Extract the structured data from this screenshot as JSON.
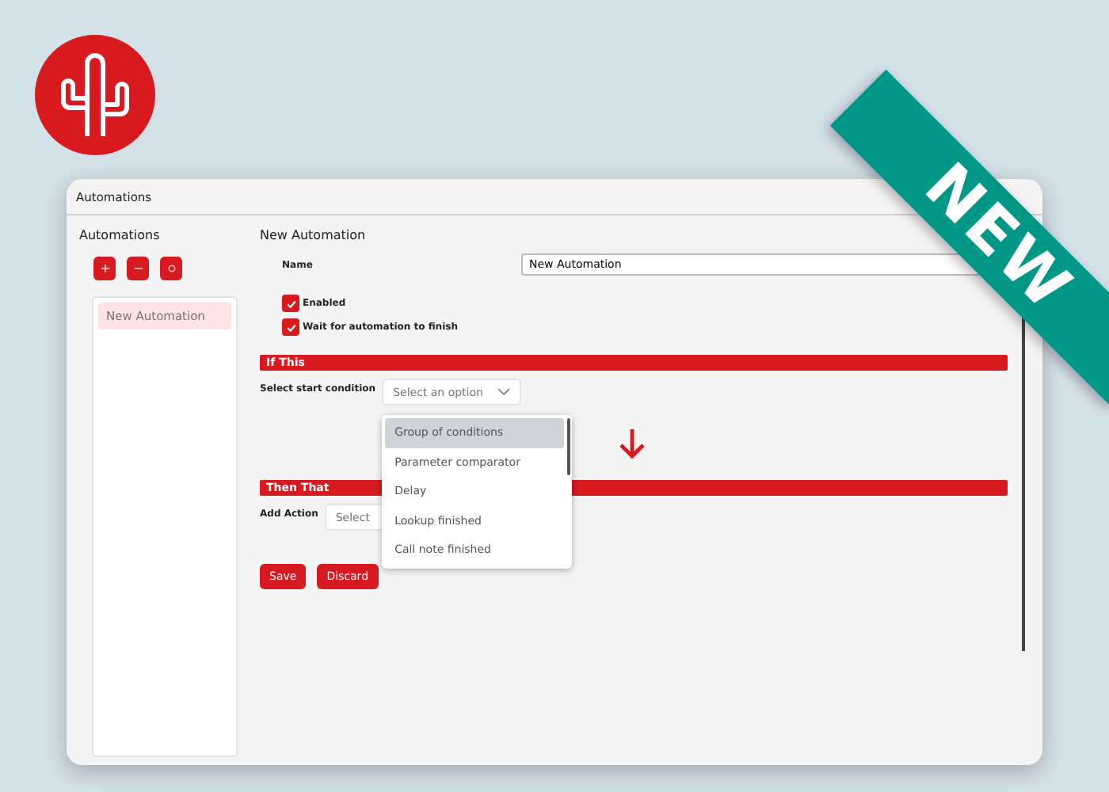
{
  "window": {
    "title": "Automations"
  },
  "sidebar": {
    "title": "Automations",
    "tools": [
      {
        "kind": "add"
      },
      {
        "kind": "remove"
      },
      {
        "kind": "copy"
      }
    ],
    "items": [
      {
        "label": "New Automation",
        "selected": true
      }
    ]
  },
  "editor": {
    "heading": "New Automation",
    "name": {
      "label": "Name",
      "value": "New Automation"
    },
    "checkboxes": [
      {
        "label": "Enabled",
        "checked": true
      },
      {
        "label": "Wait for automation to finish",
        "checked": true
      }
    ],
    "if_section": {
      "title": "If This",
      "field_label": "Select start condition",
      "placeholder": "Select an option",
      "options": [
        {
          "label": "Group of conditions",
          "selected": true
        },
        {
          "label": "Parameter comparator",
          "selected": false
        },
        {
          "label": "Delay",
          "selected": false
        },
        {
          "label": "Lookup finished",
          "selected": false
        },
        {
          "label": "Call note finished",
          "selected": false
        }
      ]
    },
    "then_section": {
      "title": "Then That",
      "field_label": "Add Action",
      "value": "Select"
    },
    "buttons": [
      "Save",
      "Discard"
    ]
  },
  "ribbon": {
    "text": "NEW"
  }
}
